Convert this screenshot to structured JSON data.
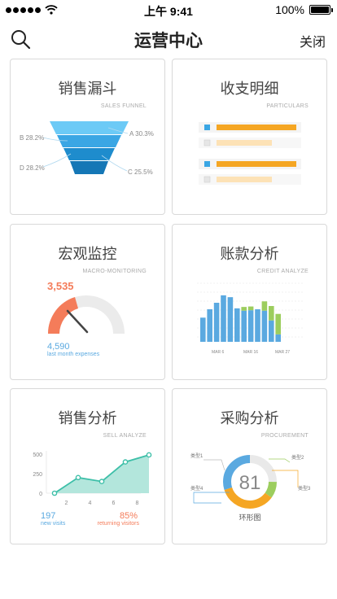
{
  "status_bar": {
    "time": "上午 9:41",
    "battery": "100%"
  },
  "nav": {
    "title": "运营中心",
    "close_label": "关闭"
  },
  "cards": {
    "sales_funnel": {
      "title": "销售漏斗",
      "subtitle": "SALES FUNNEL",
      "labels": {
        "a": "A 30.3%",
        "b": "B 28.2%",
        "c": "C 25.5%",
        "d": "D 28.2%"
      },
      "colors": [
        "#6ccaf6",
        "#3aa6e4",
        "#1e8ccd",
        "#1577b6"
      ]
    },
    "particulars": {
      "title": "收支明细",
      "subtitle": "PARTICULARS",
      "rows": [
        {
          "active": true,
          "level": 0.82
        },
        {
          "active": false,
          "level": 0.55
        },
        {
          "active": true,
          "level": 0.82
        },
        {
          "active": false,
          "level": 0.55
        }
      ]
    },
    "macro": {
      "title": "宏观监控",
      "subtitle": "MACRO-MONITORING",
      "value": "3,535",
      "expense_value": "4,590",
      "expense_label": "last month expenses",
      "gauge_level": 0.4
    },
    "credit": {
      "title": "账款分析",
      "subtitle": "CREDIT ANALYZE",
      "x_labels": [
        "MAR 6",
        "MAR 16",
        "MAR 27"
      ]
    },
    "sell": {
      "title": "销售分析",
      "subtitle": "SELL ANALYZE",
      "new_visits_value": "197",
      "new_visits_label": "new visits",
      "returning_value": "85%",
      "returning_label": "returning visitors"
    },
    "procurement": {
      "title": "采购分析",
      "subtitle": "PROCUREMENT",
      "center_value": "81",
      "chart_label": "环形图",
      "legend": [
        "类型1",
        "类型2",
        "类型3",
        "类型4"
      ]
    }
  },
  "chart_data": [
    {
      "type": "bar",
      "categories": [
        "1",
        "2",
        "3",
        "4",
        "5",
        "6",
        "7",
        "8",
        "9",
        "10",
        "11",
        "12",
        "13",
        "14",
        "15"
      ],
      "series": [
        {
          "values": [
            52,
            70,
            84,
            100,
            96,
            72,
            67,
            68,
            70,
            67,
            46,
            16,
            0,
            0,
            0
          ]
        },
        {
          "values": [
            0,
            0,
            0,
            0,
            0,
            0,
            8,
            8,
            0,
            20,
            31,
            44,
            0,
            0,
            0
          ]
        }
      ],
      "x_tick_labels": [
        "MAR 6",
        "MAR 16",
        "MAR 27"
      ],
      "ylim": [
        0,
        140
      ],
      "colors": [
        "#5aa9e0",
        "#9ccd5e"
      ]
    },
    {
      "type": "area",
      "x": [
        1,
        3,
        5,
        7,
        9
      ],
      "values": [
        0,
        200,
        150,
        400,
        490
      ],
      "x_tick_labels": [
        "2",
        "4",
        "6",
        "8"
      ],
      "y_tick_labels": [
        "500",
        "250",
        "0"
      ],
      "ylim": [
        0,
        500
      ],
      "colors": [
        "#3dbfa8",
        "#b3e6dc"
      ]
    },
    {
      "type": "pie",
      "categories": [
        "类型1",
        "类型2",
        "类型3",
        "类型4"
      ],
      "values": [
        25,
        10,
        35,
        30
      ],
      "colors": [
        "#e9e9e9",
        "#9ccd5e",
        "#f5a623",
        "#5aa9e0"
      ],
      "center_label": "81"
    }
  ]
}
